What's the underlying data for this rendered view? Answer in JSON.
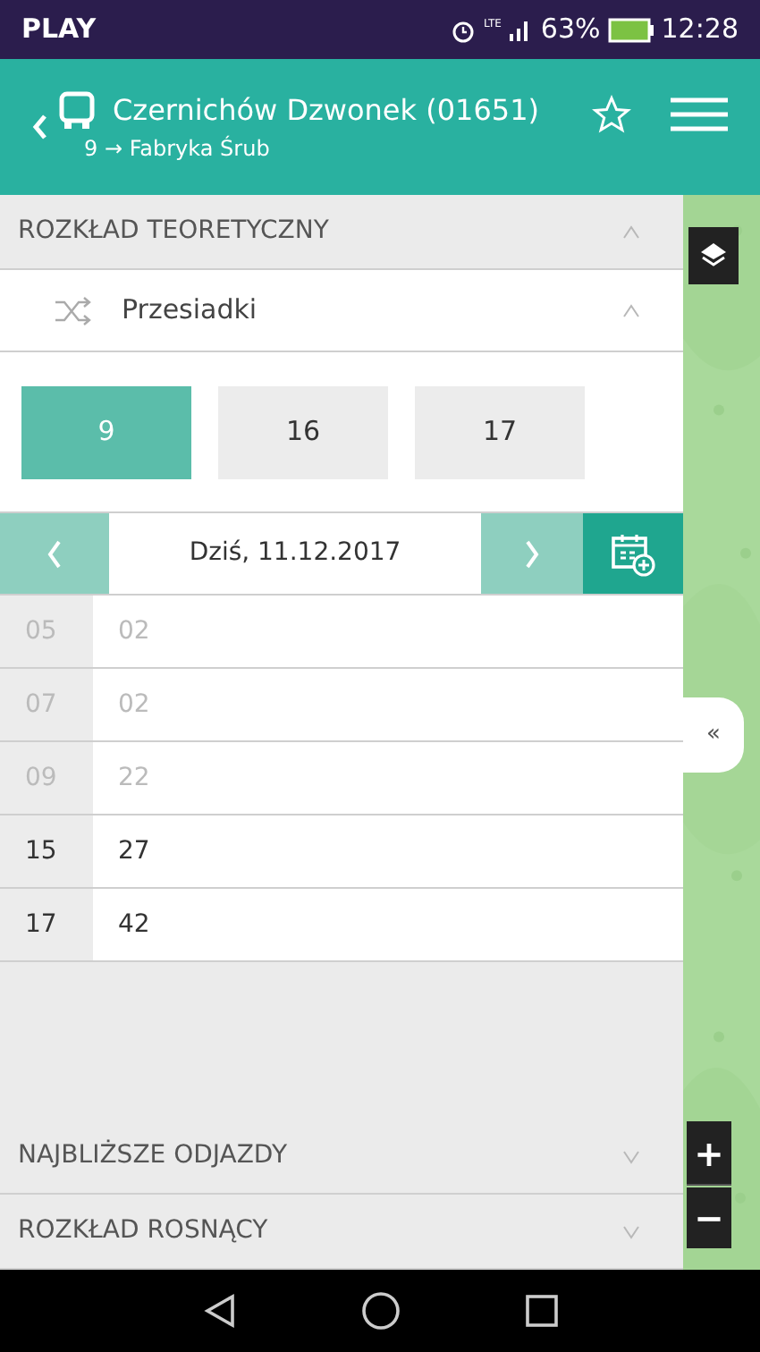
{
  "status_bar": {
    "carrier": "PLAY",
    "network": "LTE",
    "battery": "63%",
    "time": "12:28"
  },
  "header": {
    "title": "Czernichów Dzwonek (01651)",
    "subtitle": "9 → Fabryka Śrub",
    "favorite": false
  },
  "sections_top": [
    {
      "label": "ROZKŁAD TEORETYCZNY",
      "expanded": true
    }
  ],
  "transfers": {
    "label": "Przesiadki",
    "expanded": true
  },
  "lines": [
    {
      "label": "9",
      "selected": true
    },
    {
      "label": "16",
      "selected": false
    },
    {
      "label": "17",
      "selected": false
    }
  ],
  "date": {
    "label": "Dziś, 11.12.2017"
  },
  "timetable": [
    {
      "hour": "05",
      "minutes": "02",
      "past": true
    },
    {
      "hour": "07",
      "minutes": "02",
      "past": true
    },
    {
      "hour": "09",
      "minutes": "22",
      "past": true
    },
    {
      "hour": "15",
      "minutes": "27",
      "past": false
    },
    {
      "hour": "17",
      "minutes": "42",
      "past": false
    }
  ],
  "sections_bottom": [
    {
      "label": "NAJBLIŻSZE ODJAZDY",
      "expanded": false
    },
    {
      "label": "ROZKŁAD ROSNĄCY",
      "expanded": false
    }
  ],
  "map": {
    "collapse": "«",
    "zoom_in": "+",
    "zoom_out": "−"
  }
}
